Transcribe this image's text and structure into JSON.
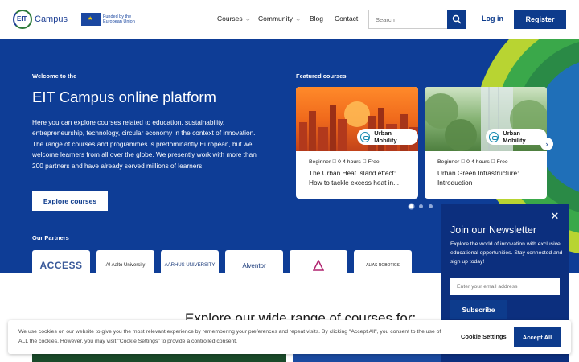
{
  "header": {
    "logo_text": "Campus",
    "logo_mark_text": "EIT",
    "eu_text": "Funded by the European Union",
    "nav": [
      {
        "label": "Courses",
        "dropdown": true
      },
      {
        "label": "Community",
        "dropdown": true
      },
      {
        "label": "Blog",
        "dropdown": false
      },
      {
        "label": "Contact",
        "dropdown": false
      }
    ],
    "search_placeholder": "Search",
    "login_label": "Log in",
    "register_label": "Register"
  },
  "hero": {
    "welcome": "Welcome to the",
    "title": "EIT Campus online platform",
    "description": "Here you can explore courses related to education, sustainability, entrepreneurship, technology, circular economy in the context of innovation. The range of courses and programmes is predominantly European, but we welcome learners from all over the globe. We presently work with more than 200 partners and have already served millions of learners.",
    "explore_button": "Explore courses",
    "featured_title": "Featured courses",
    "courses": [
      {
        "badge": "Urban Mobility",
        "meta": "Beginner ⃝ 0-4 hours ⃝ Free",
        "title": "The Urban Heat Island effect: How to tackle excess heat in..."
      },
      {
        "badge": "Urban Mobility",
        "meta": "Beginner ⃝ 0-4 hours ⃝ Free",
        "title": "Urban Green Infrastructure: Introduction"
      }
    ],
    "carousel_dots": 3,
    "active_dot": 0,
    "partners_title": "Our Partners",
    "partners": [
      "ACCESS",
      "A! Aalto University",
      "AARHUS UNIVERSITY",
      "Alventor",
      "",
      "ALIAS ROBOTICS"
    ]
  },
  "explore_heading": "Explore our wide range of courses for:",
  "newsletter": {
    "title": "Join our Newsletter",
    "description": "Explore the world of innovation with exclusive educational opportunities. Stay connected and sign up today!",
    "email_placeholder": "Enter your email address",
    "subscribe_label": "Subscribe"
  },
  "cookie": {
    "text": "We use cookies on our website to give you the most relevant experience by remembering your preferences and repeat visits. By clicking \"Accept All\", you consent to the use of ALL the cookies. However, you may visit \"Cookie Settings\" to provide a controlled consent.",
    "settings_label": "Cookie Settings",
    "accept_label": "Accept All"
  },
  "colors": {
    "brand_blue": "#0d3b8c",
    "hero_blue": "#0e3d96",
    "newsletter_blue": "#0c2f7e",
    "accent_green": "#3aa84a",
    "accent_lime": "#b8d432"
  }
}
